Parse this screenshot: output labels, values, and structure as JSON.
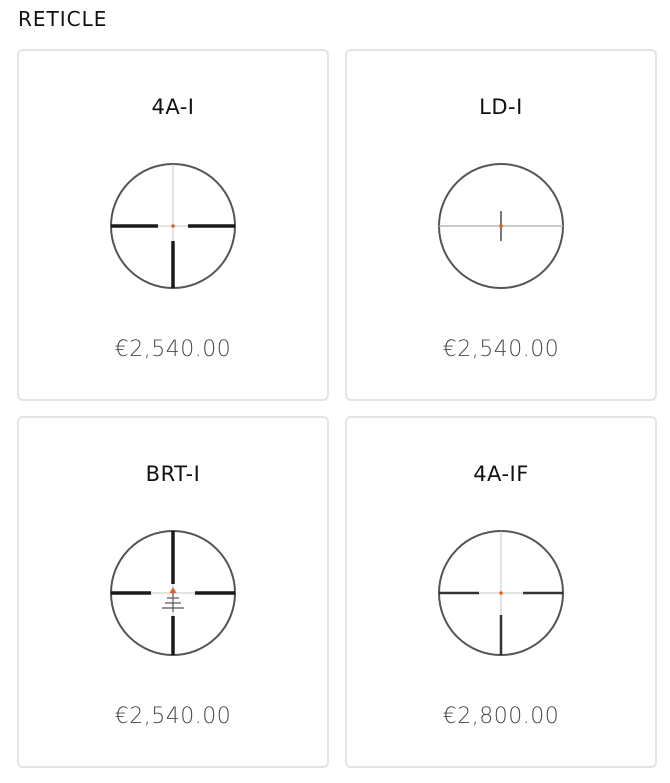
{
  "section": {
    "title": "RETICLE"
  },
  "products": [
    {
      "name": "4A-I",
      "price": "€2,540.00",
      "reticle_icon": "4a-i-reticle-icon"
    },
    {
      "name": "LD-I",
      "price": "€2,540.00",
      "reticle_icon": "ld-i-reticle-icon"
    },
    {
      "name": "BRT-I",
      "price": "€2,540.00",
      "reticle_icon": "brt-i-reticle-icon"
    },
    {
      "name": "4A-IF",
      "price": "€2,800.00",
      "reticle_icon": "4a-if-reticle-icon"
    }
  ],
  "colors": {
    "reticle_line": "#1a1a1a",
    "reticle_thin": "#bdbdbd",
    "illuminated_dot": "#d9652b",
    "card_border": "#e4e4e4",
    "price_text": "#4a4a4a"
  }
}
